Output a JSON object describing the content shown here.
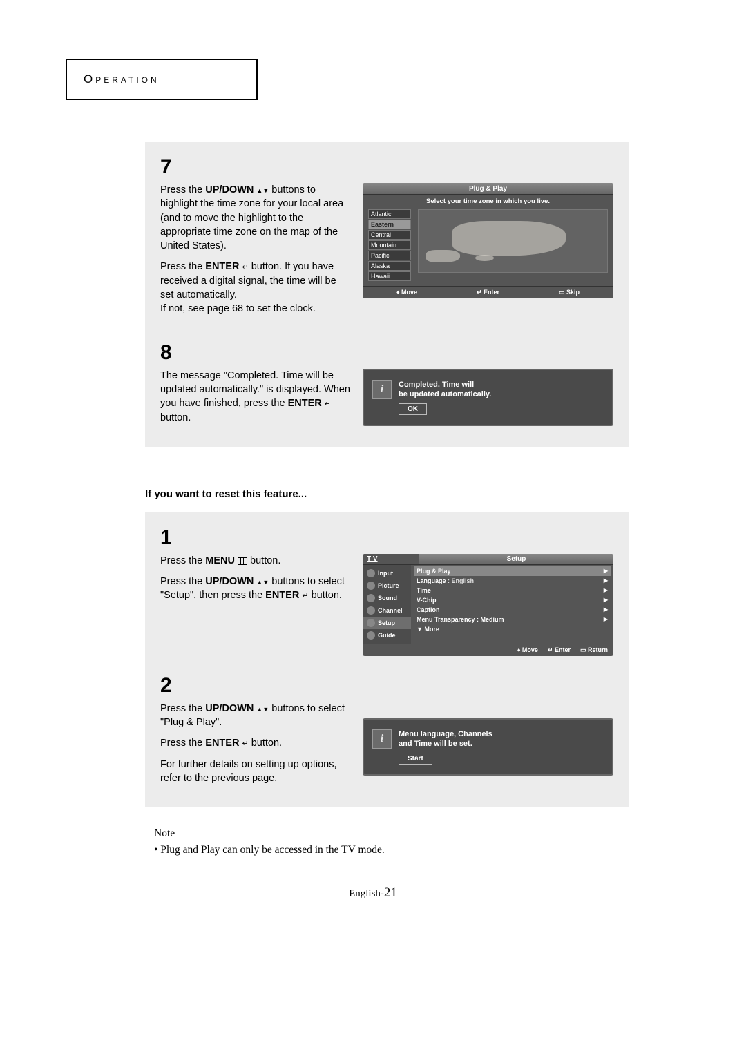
{
  "section_label": "Operation",
  "step7": {
    "num": "7",
    "para1_a": "Press the ",
    "para1_b": "UP/DOWN",
    "para1_c": " buttons to highlight the time zone for your local area (and to move the  highlight to the appropriate time zone on the map of the United States).",
    "para2_a": "Press the ",
    "para2_b": "ENTER",
    "para2_c": " button. If you have received a digital signal, the time will be set automatically.",
    "para2_d": "If not, see page 68 to set the clock."
  },
  "tz": {
    "title": "Plug & Play",
    "subtitle": "Select your time zone in which you live.",
    "items": [
      "Atlantic",
      "Eastern",
      "Central",
      "Mountain",
      "Pacific",
      "Alaska",
      "Hawaii"
    ],
    "selected": 1,
    "footer": {
      "move": "Move",
      "enter": "Enter",
      "skip": "Skip"
    }
  },
  "step8": {
    "num": "8",
    "para_a": "The message \"Completed. Time will be updated automatically.\" is displayed. When you have finished, press the ",
    "para_b": "ENTER",
    "para_c": " button."
  },
  "dlg8": {
    "line1": "Completed. Time will",
    "line2": "be updated automatically.",
    "ok": "OK"
  },
  "reset_heading": "If you want to reset this feature...",
  "step1": {
    "num": "1",
    "p1_a": "Press the ",
    "p1_b": "MENU",
    "p1_c": "  button.",
    "p2_a": "Press the ",
    "p2_b": "UP/DOWN",
    "p2_c": " buttons to select \"Setup\", then press the ",
    "p2_d": "ENTER",
    "p2_e": " button."
  },
  "tvmenu": {
    "tv": "T V",
    "headerR": "Setup",
    "sidebar": [
      "Input",
      "Picture",
      "Sound",
      "Channel",
      "Setup",
      "Guide"
    ],
    "sidebar_sel": 4,
    "rows": [
      {
        "label": "Plug & Play",
        "val": "",
        "arrow": true,
        "sel": true
      },
      {
        "label": "Language",
        "val": ": English",
        "arrow": true,
        "sel": false
      },
      {
        "label": "Time",
        "val": "",
        "arrow": true,
        "sel": false
      },
      {
        "label": "V-Chip",
        "val": "",
        "arrow": true,
        "sel": false
      },
      {
        "label": "Caption",
        "val": "",
        "arrow": true,
        "sel": false
      },
      {
        "label": "Menu Transparency : Medium",
        "val": "",
        "arrow": true,
        "sel": false
      },
      {
        "label": "▼ More",
        "val": "",
        "arrow": false,
        "sel": false
      }
    ],
    "footer": {
      "move": "Move",
      "enter": "Enter",
      "return": "Return"
    }
  },
  "step2": {
    "num": "2",
    "p1_a": "Press the ",
    "p1_b": "UP/DOWN",
    "p1_c": " buttons to select \"Plug & Play\".",
    "p2_a": "Press the ",
    "p2_b": "ENTER",
    "p2_c": "   button.",
    "p3": "For further details on setting up options, refer to the previous page."
  },
  "dlg2": {
    "line1": "Menu language, Channels",
    "line2": "and Time will be set.",
    "start": "Start"
  },
  "note_label": "Note",
  "note_bullet": "• Plug and Play can only be accessed in the TV mode.",
  "footer_page_a": "English-",
  "footer_page_b": "21"
}
